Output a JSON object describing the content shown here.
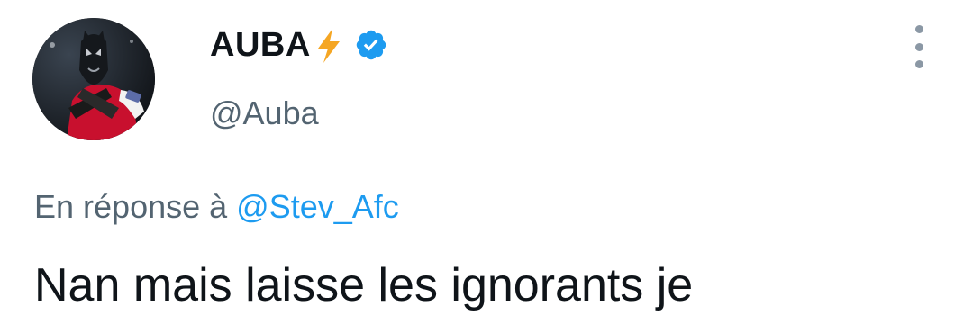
{
  "tweet": {
    "display_name": "AUBA",
    "handle": "@Auba",
    "reply_prefix": "En réponse à",
    "reply_to": "@Stev_Afc",
    "text": "Nan mais laisse les ignorants je"
  },
  "icons": {
    "name_emoji": "lightning-bolt-icon",
    "verified": "verified-badge-icon",
    "more": "more-options-icon"
  },
  "colors": {
    "verified_blue": "#1d9bf0",
    "mention_blue": "#1d9bf0",
    "bolt_orange": "#f5a623",
    "secondary_text": "#536471",
    "primary_text": "#0f1419"
  }
}
